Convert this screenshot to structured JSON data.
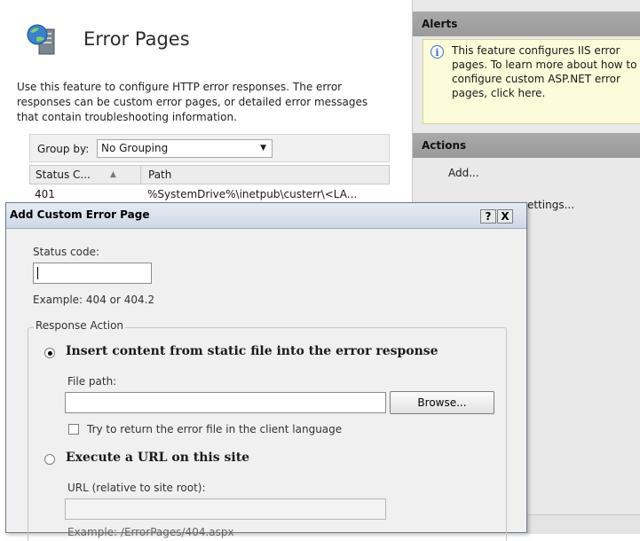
{
  "feature": {
    "title": "Error Pages",
    "description": "Use this feature to configure HTTP error responses. The error responses can be custom error pages, or detailed error messages that contain troubleshooting information.",
    "group_by_label": "Group by:",
    "group_by_value": "No Grouping",
    "columns": [
      "Status C...",
      "Path"
    ],
    "rows": [
      {
        "status": "401",
        "path": "%SystemDrive%\\inetpub\\custerr\\<LA..."
      }
    ]
  },
  "alerts": {
    "title": "Alerts",
    "message": "This feature configures IIS error pages. To learn more about how to configure custom ASP.NET error pages, click here."
  },
  "actions": {
    "title": "Actions",
    "items": [
      "Add...",
      "ettings..."
    ]
  },
  "dialog": {
    "title": "Add Custom Error Page",
    "help_label": "?",
    "close_label": "X",
    "status_code_label": "Status code:",
    "status_code_value": "",
    "status_code_example": "Example: 404 or 404.2",
    "response_action_label": "Response Action",
    "option_static": "Insert content from static file into the error response",
    "file_path_label": "File path:",
    "file_path_value": "",
    "browse_label": "Browse...",
    "try_language_label": "Try to return the error file in the client language",
    "option_url": "Execute a URL on this site",
    "url_label": "URL (relative to site root):",
    "url_value": "",
    "url_example": "Example: /ErrorPages/404.aspx"
  },
  "state": {
    "selected_option": "static",
    "try_language_checked": false
  },
  "icons": [
    "error-pages-icon",
    "info-icon",
    "dropdown-arrow-icon",
    "sort-ascending-icon",
    "help-icon",
    "close-icon"
  ]
}
